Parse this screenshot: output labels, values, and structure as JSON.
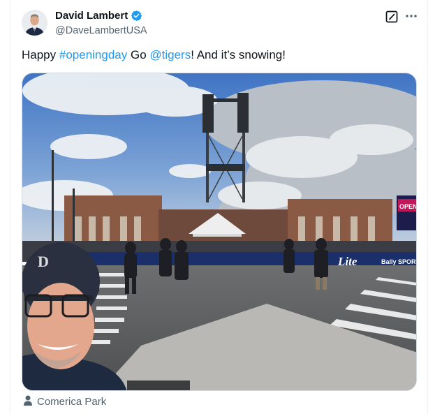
{
  "author": {
    "name": "David Lambert",
    "handle": "@DaveLambertUSA",
    "verified": true,
    "verified_color": "#1d9bf0"
  },
  "tweet": {
    "parts": [
      {
        "text": "Happy ",
        "type": "text"
      },
      {
        "text": "#openingday",
        "type": "hashtag"
      },
      {
        "text": " Go ",
        "type": "text"
      },
      {
        "text": "@tigers",
        "type": "mention"
      },
      {
        "text": "! And it’s snowing!",
        "type": "text"
      }
    ]
  },
  "actions": {
    "grok_icon": "grok-icon",
    "more_icon": "more-icon"
  },
  "media": {
    "signs": {
      "lite": "Lite",
      "bally": "Bally SPORTS",
      "opening": "OPENING"
    }
  },
  "location": {
    "label": "Comerica Park",
    "icon": "person-pin-icon"
  },
  "colors": {
    "accent": "#1d9bf0",
    "secondary_text": "#536471",
    "primary_text": "#0f1419",
    "border": "#cfd9de"
  }
}
